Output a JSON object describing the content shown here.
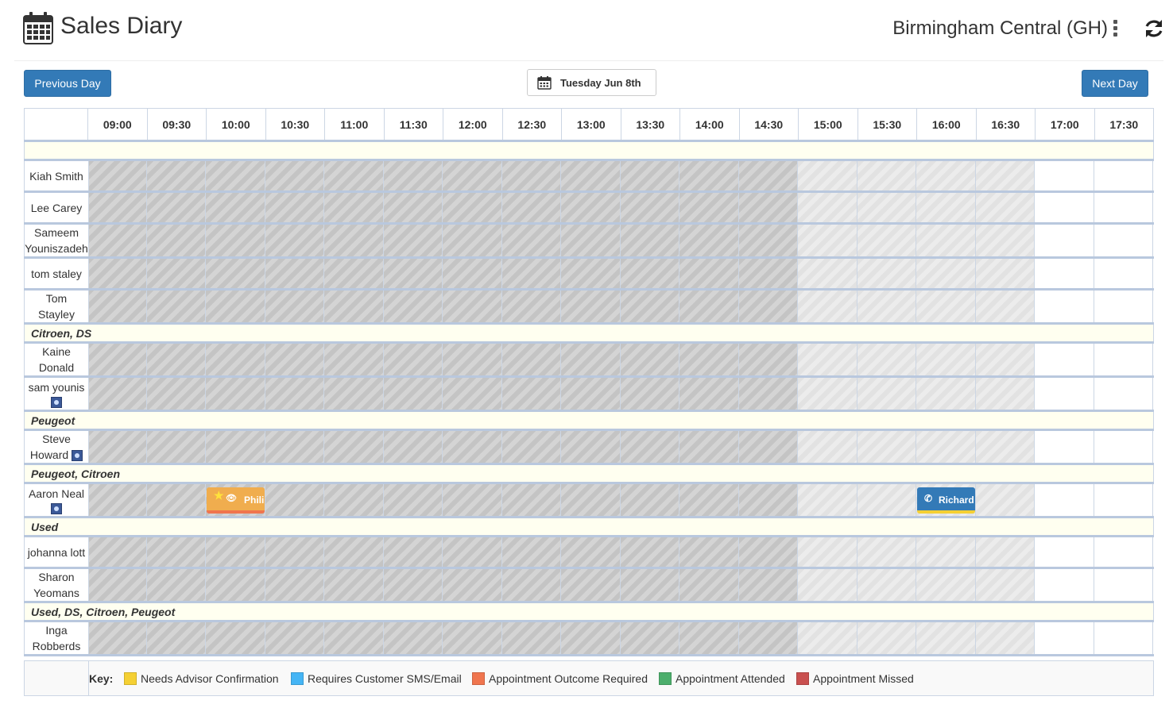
{
  "header": {
    "title": "Sales Diary",
    "branch": "Birmingham Central (GH)"
  },
  "nav": {
    "prev_label": "Previous Day",
    "next_label": "Next Day",
    "date_label": "Tuesday Jun 8th"
  },
  "times": [
    "09:00",
    "09:30",
    "10:00",
    "10:30",
    "11:00",
    "11:30",
    "12:00",
    "12:30",
    "13:00",
    "13:30",
    "14:00",
    "14:30",
    "15:00",
    "15:30",
    "16:00",
    "16:30",
    "17:00",
    "17:30"
  ],
  "rows": [
    {
      "type": "group",
      "label": ""
    },
    {
      "type": "person",
      "line1": "Kiah Smith",
      "line2": "",
      "icon": false
    },
    {
      "type": "person",
      "line1": "Lee Carey",
      "line2": "",
      "icon": false
    },
    {
      "type": "person",
      "line1": "Sameem",
      "line2": "Youniszadeh",
      "icon": false
    },
    {
      "type": "person",
      "line1": "tom staley",
      "line2": "",
      "icon": false
    },
    {
      "type": "person",
      "line1": "Tom",
      "line2": "Stayley",
      "icon": false
    },
    {
      "type": "group",
      "label": "Citroen, DS"
    },
    {
      "type": "person",
      "line1": "Kaine",
      "line2": "Donald",
      "icon": false
    },
    {
      "type": "person",
      "line1": "sam younis",
      "line2": "",
      "icon": true
    },
    {
      "type": "group",
      "label": "Peugeot"
    },
    {
      "type": "person",
      "line1": "Steve",
      "line2": "Howard",
      "icon": true,
      "icon_inline": true
    },
    {
      "type": "group",
      "label": "Peugeot, Citroen"
    },
    {
      "type": "person",
      "line1": "Aaron Neal",
      "line2": "",
      "icon": true
    },
    {
      "type": "group",
      "label": "Used"
    },
    {
      "type": "person",
      "line1": "johanna lott",
      "line2": "",
      "icon": false
    },
    {
      "type": "person",
      "line1": "Sharon",
      "line2": "Yeomans",
      "icon": false
    },
    {
      "type": "group",
      "label": "Used, DS, Citroen, Peugeot"
    },
    {
      "type": "person",
      "line1": "Inga",
      "line2": "Robberds",
      "icon": false
    }
  ],
  "appointments": [
    {
      "name": "Phili",
      "icons": [
        "star-icon",
        "eye-icon"
      ],
      "color": "#f0ad4e",
      "bar": "#f0754e"
    },
    {
      "name": "Richard",
      "icons": [
        "phone-icon"
      ],
      "color": "#337ab7",
      "bar": "#f5d033"
    }
  ],
  "key": {
    "label": "Key:",
    "items": [
      {
        "label": "Needs Advisor Confirmation",
        "color": "#f5d033"
      },
      {
        "label": "Requires Customer SMS/Email",
        "color": "#45b5f5"
      },
      {
        "label": "Appointment Outcome Required",
        "color": "#f0754e"
      },
      {
        "label": "Appointment Attended",
        "color": "#4cae6c"
      },
      {
        "label": "Appointment Missed",
        "color": "#c9504f"
      }
    ]
  }
}
